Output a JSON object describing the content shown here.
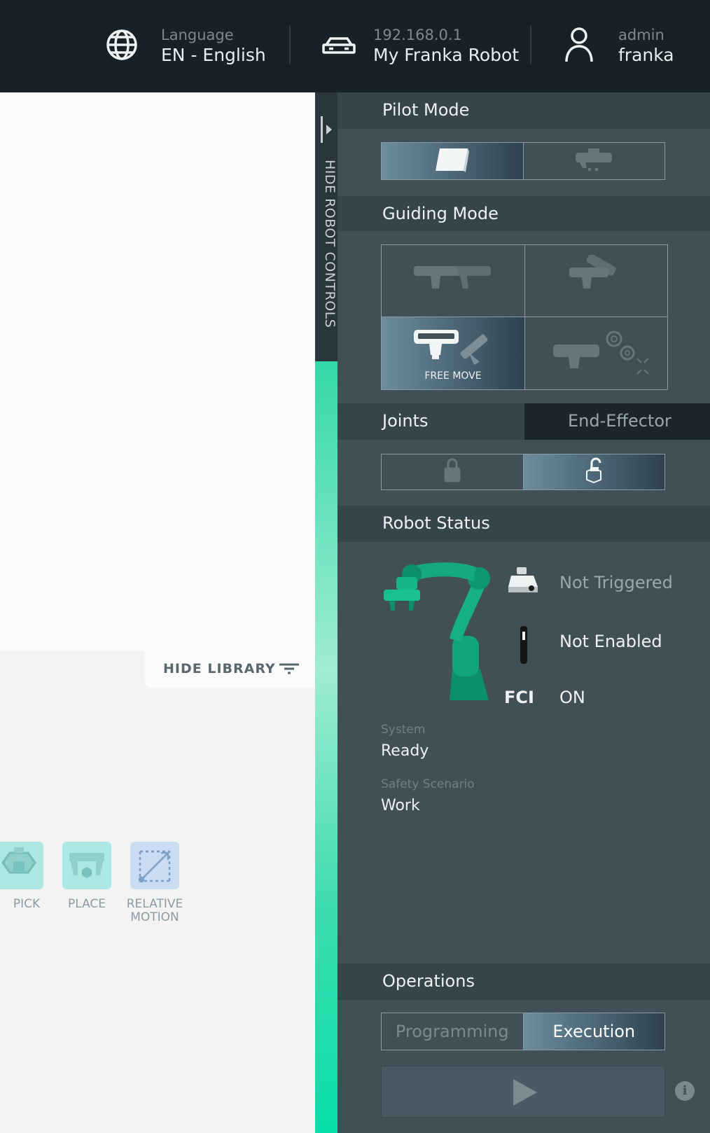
{
  "header": {
    "language": {
      "label": "Language",
      "value": "EN - English",
      "icon": "globe-icon"
    },
    "robot": {
      "ip": "192.168.0.1",
      "name": "My Franka Robot",
      "icon": "robot-controller-icon"
    },
    "user": {
      "role": "admin",
      "name": "franka",
      "icon": "user-icon"
    }
  },
  "library": {
    "hide_label": "HIDE LIBRARY",
    "items": [
      {
        "label": "PICK",
        "icon": "pick-gripper-icon",
        "color": "#aee8e4"
      },
      {
        "label": "PLACE",
        "icon": "place-gripper-icon",
        "color": "#aee8e4"
      },
      {
        "label": "RELATIVE MOTION",
        "line1": "RELATIVE",
        "line2": "MOTION",
        "icon": "relative-motion-icon",
        "color": "#c9dcf2"
      }
    ]
  },
  "side_tab": {
    "label": "HIDE ROBOT CONTROLS",
    "accent": "#06dfa8"
  },
  "pilot_mode": {
    "title": "Pilot Mode",
    "options": [
      {
        "icon": "tablet-icon",
        "active": true
      },
      {
        "icon": "pilot-grip-icon",
        "active": false
      }
    ]
  },
  "guiding_mode": {
    "title": "Guiding Mode",
    "options": [
      {
        "icon": "translation-mode-icon",
        "active": false
      },
      {
        "icon": "rotation-mode-icon",
        "active": false
      },
      {
        "icon": "free-move-icon",
        "label": "FREE MOVE",
        "active": true
      },
      {
        "icon": "user-defined-mode-icon",
        "active": false
      }
    ]
  },
  "frame_tabs": {
    "joints": "Joints",
    "end_effector": "End-Effector",
    "options": [
      {
        "icon": "lock-closed-icon",
        "active": false
      },
      {
        "icon": "lock-open-icon",
        "active": true
      }
    ]
  },
  "robot_status": {
    "title": "Robot Status",
    "external_activation": "Not Triggered",
    "enabling_device": "Not Enabled",
    "fci_label": "FCI",
    "fci_value": "ON",
    "system_label": "System",
    "system_value": "Ready",
    "safety_label": "Safety Scenario",
    "safety_value": "Work"
  },
  "operations": {
    "title": "Operations",
    "programming": "Programming",
    "execution": "Execution",
    "active": "Execution",
    "play_icon": "play-icon",
    "info_icon": "info-icon",
    "info_glyph": "i"
  }
}
